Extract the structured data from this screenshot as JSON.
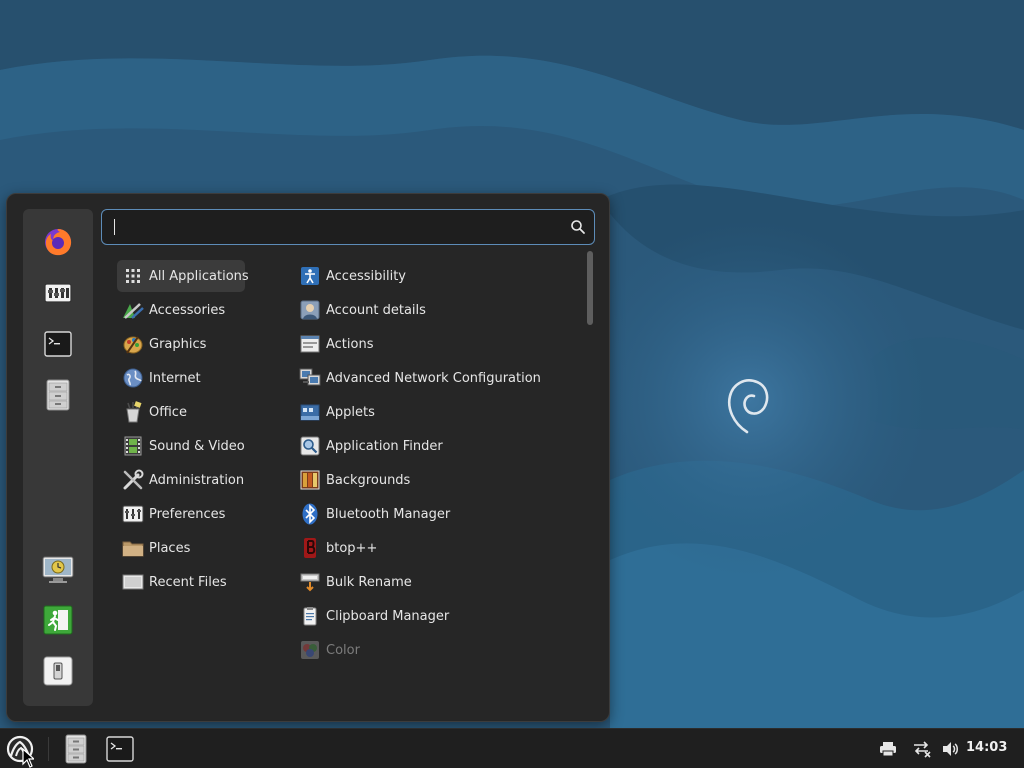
{
  "search": {
    "value": "",
    "placeholder": "",
    "icon": "search-icon"
  },
  "sidebar": {
    "favorites": [
      {
        "name": "firefox",
        "icon": "firefox-icon"
      },
      {
        "name": "settings",
        "icon": "settings-icon"
      },
      {
        "name": "terminal",
        "icon": "terminal-icon"
      },
      {
        "name": "files",
        "icon": "file-cabinet-icon"
      }
    ],
    "session": [
      {
        "name": "lock-screen",
        "icon": "lock-screen-icon"
      },
      {
        "name": "logout",
        "icon": "logout-icon"
      },
      {
        "name": "shutdown",
        "icon": "power-switch-icon"
      }
    ]
  },
  "categories": [
    {
      "label": "All Applications",
      "icon": "grid-icon",
      "selected": true
    },
    {
      "label": "Accessories",
      "icon": "accessories-icon"
    },
    {
      "label": "Graphics",
      "icon": "graphics-icon"
    },
    {
      "label": "Internet",
      "icon": "globe-icon"
    },
    {
      "label": "Office",
      "icon": "office-icon"
    },
    {
      "label": "Sound & Video",
      "icon": "film-icon"
    },
    {
      "label": "Administration",
      "icon": "tools-icon"
    },
    {
      "label": "Preferences",
      "icon": "preferences-icon"
    },
    {
      "label": "Places",
      "icon": "folder-icon"
    },
    {
      "label": "Recent Files",
      "icon": "recent-files-icon"
    }
  ],
  "applications": [
    {
      "label": "Accessibility",
      "icon": "accessibility-icon"
    },
    {
      "label": "Account details",
      "icon": "account-icon"
    },
    {
      "label": "Actions",
      "icon": "actions-icon"
    },
    {
      "label": "Advanced Network Configuration",
      "icon": "network-icon"
    },
    {
      "label": "Applets",
      "icon": "applets-icon"
    },
    {
      "label": "Application Finder",
      "icon": "magnifier-icon"
    },
    {
      "label": "Backgrounds",
      "icon": "backgrounds-icon"
    },
    {
      "label": "Bluetooth Manager",
      "icon": "bluetooth-icon"
    },
    {
      "label": "btop++",
      "icon": "btop-icon"
    },
    {
      "label": "Bulk Rename",
      "icon": "bulk-rename-icon"
    },
    {
      "label": "Clipboard Manager",
      "icon": "clipboard-icon"
    },
    {
      "label": "Color",
      "icon": "color-icon",
      "dimmed": true
    }
  ],
  "taskbar": {
    "menu_button_icon": "menu-logo-icon",
    "windows": [
      {
        "name": "file-manager",
        "icon": "file-cabinet-icon"
      },
      {
        "name": "terminal",
        "icon": "terminal-icon"
      }
    ],
    "tray": [
      {
        "name": "printer",
        "icon": "printer-icon"
      },
      {
        "name": "network",
        "icon": "network-disconnected-icon"
      },
      {
        "name": "volume",
        "icon": "volume-icon"
      }
    ],
    "clock": "14:03"
  },
  "colors": {
    "desktop": "#2c5a7c",
    "menu_bg": "#262626",
    "sidebar_bg": "#383838",
    "search_border": "#5d8cb8",
    "taskbar_bg": "#1f1f1f"
  }
}
